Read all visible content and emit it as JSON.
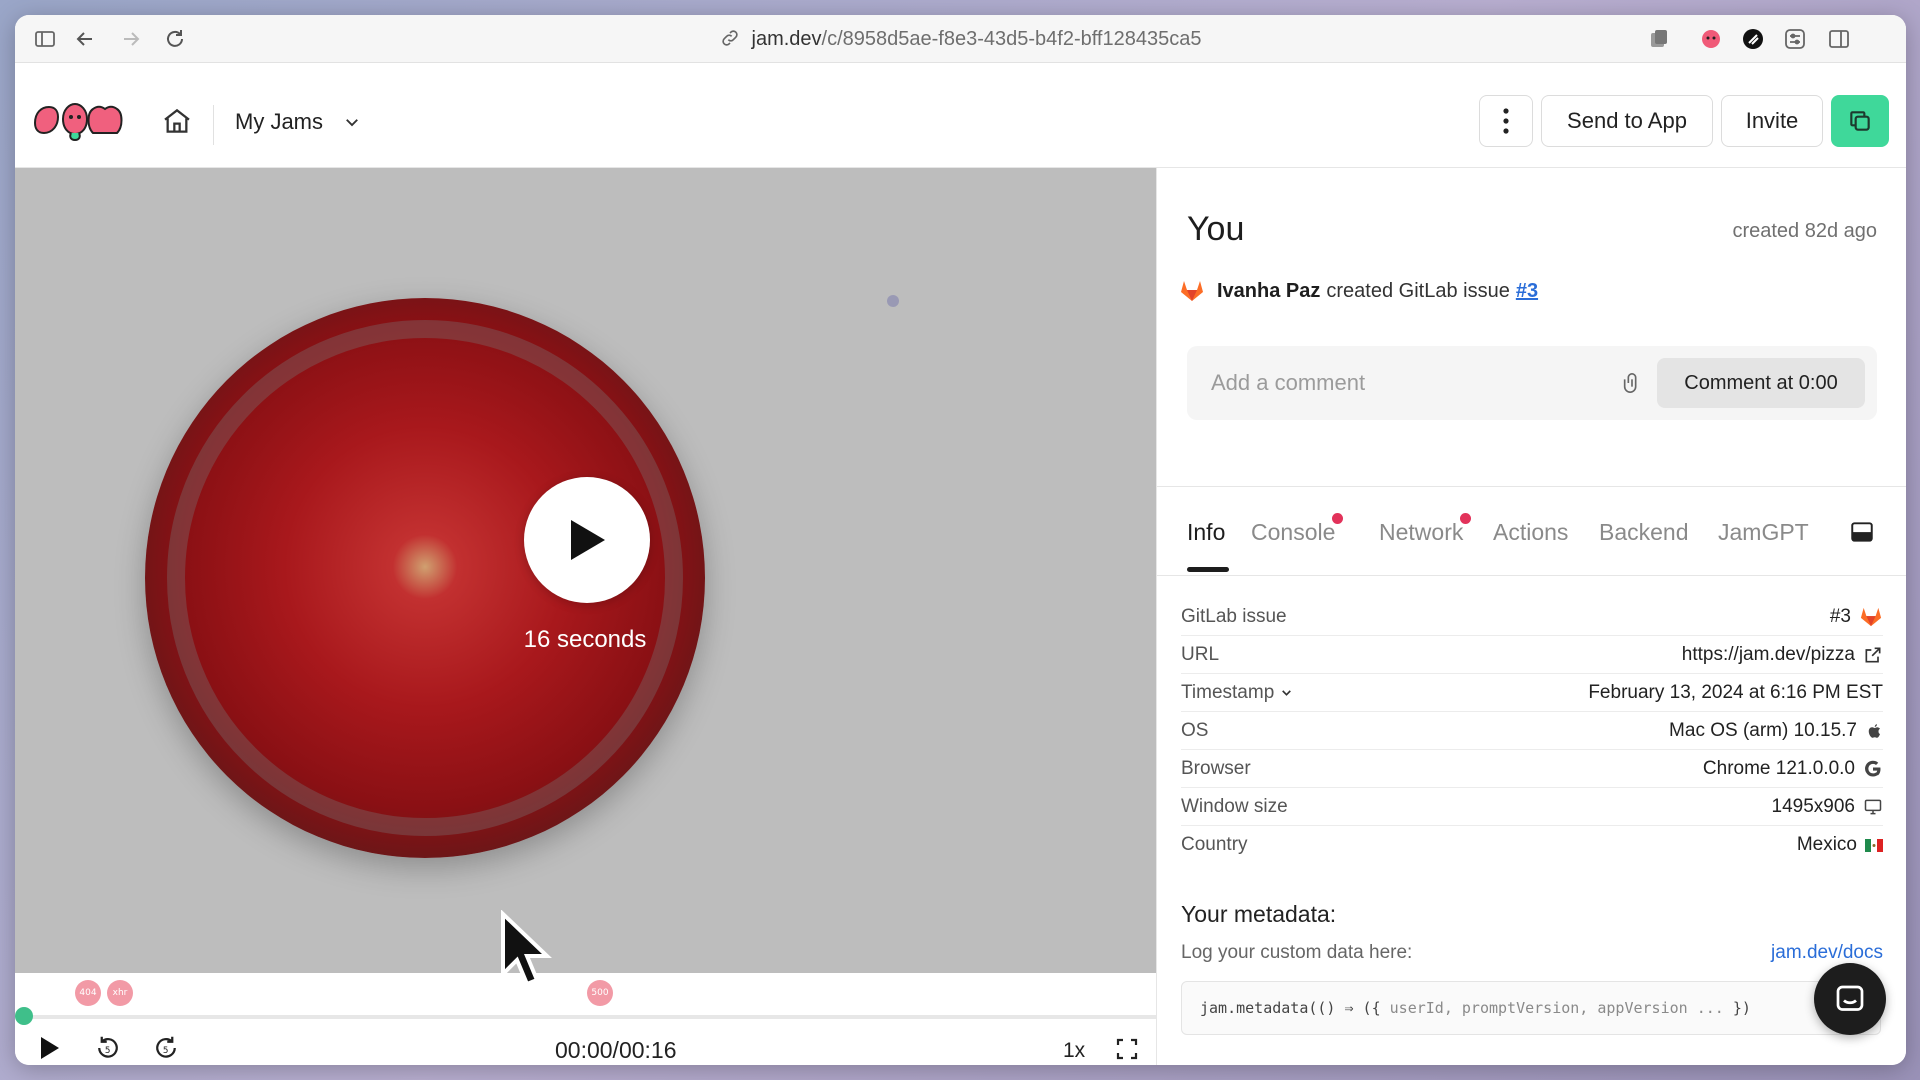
{
  "browser": {
    "url_host": "jam.dev",
    "url_path": "/c/8958d5ae-f8e3-43d5-b4f2-bff128435ca5"
  },
  "header": {
    "workspace": "My Jams",
    "send_to_app": "Send to App",
    "invite": "Invite"
  },
  "video": {
    "duration_label": "16 seconds",
    "time": "00:00/00:16",
    "speed": "1x",
    "markers": [
      {
        "label": "404"
      },
      {
        "label": "xhr"
      },
      {
        "label": "500"
      }
    ]
  },
  "panel": {
    "author": "You",
    "created": "created 82d ago",
    "activity": {
      "user": "Ivanha Paz",
      "text": "created GitLab issue",
      "link": "#3"
    },
    "comment": {
      "placeholder": "Add a comment",
      "button": "Comment at 0:00"
    },
    "tabs": [
      {
        "label": "Info",
        "active": true
      },
      {
        "label": "Console",
        "badge": true
      },
      {
        "label": "Network",
        "badge": true
      },
      {
        "label": "Actions"
      },
      {
        "label": "Backend"
      },
      {
        "label": "JamGPT"
      }
    ],
    "info": [
      {
        "key": "GitLab issue",
        "value": "#3",
        "icon": "gitlab-icon"
      },
      {
        "key": "URL",
        "value": "https://jam.dev/pizza",
        "icon": "external-link-icon"
      },
      {
        "key": "Timestamp",
        "value": "February 13, 2024 at 6:16 PM EST",
        "icon": ""
      },
      {
        "key": "OS",
        "value": "Mac OS (arm) 10.15.7",
        "icon": "apple-icon"
      },
      {
        "key": "Browser",
        "value": "Chrome 121.0.0.0",
        "icon": "google-icon"
      },
      {
        "key": "Window size",
        "value": "1495x906",
        "icon": "monitor-icon"
      },
      {
        "key": "Country",
        "value": "Mexico",
        "icon": "mexico-flag-icon"
      }
    ],
    "metadata": {
      "title": "Your metadata:",
      "subtitle": "Log your custom data here:",
      "link": "jam.dev/docs",
      "code_a": "jam.metadata(() ⇒ ({ ",
      "code_b": "userId, promptVersion, appVersion ... ",
      "code_c": "})"
    }
  },
  "colors": {
    "accent": "#3fd89a",
    "link": "#2a6dd8",
    "badge": "#e2325a"
  }
}
